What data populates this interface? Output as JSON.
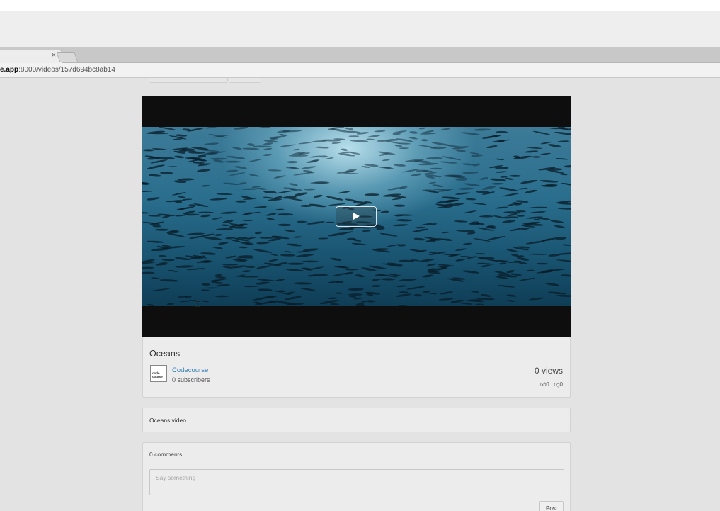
{
  "browser": {
    "tab_close_glyph": "×",
    "url_host": "e.app",
    "url_rest": ":8000/videos/157d694bc8ab14"
  },
  "video": {
    "title": "Oceans",
    "channel": {
      "name": "Codecourse",
      "subscribers": "0 subscribers",
      "avatar_text": "code course"
    },
    "views": "0 views",
    "likes": "0",
    "dislikes": "0",
    "description": "Oceans video"
  },
  "comments": {
    "count_label": "0 comments",
    "placeholder": "Say something",
    "post_label": "Post"
  },
  "colors": {
    "link": "#2f7fb6",
    "page_bg": "#e3e3e3",
    "card_bg": "#ececec",
    "player_bg": "#0e0e0e"
  },
  "icons": [
    "close-icon",
    "play-icon",
    "thumbs-up-icon",
    "thumbs-down-icon",
    "text-cursor-icon"
  ]
}
